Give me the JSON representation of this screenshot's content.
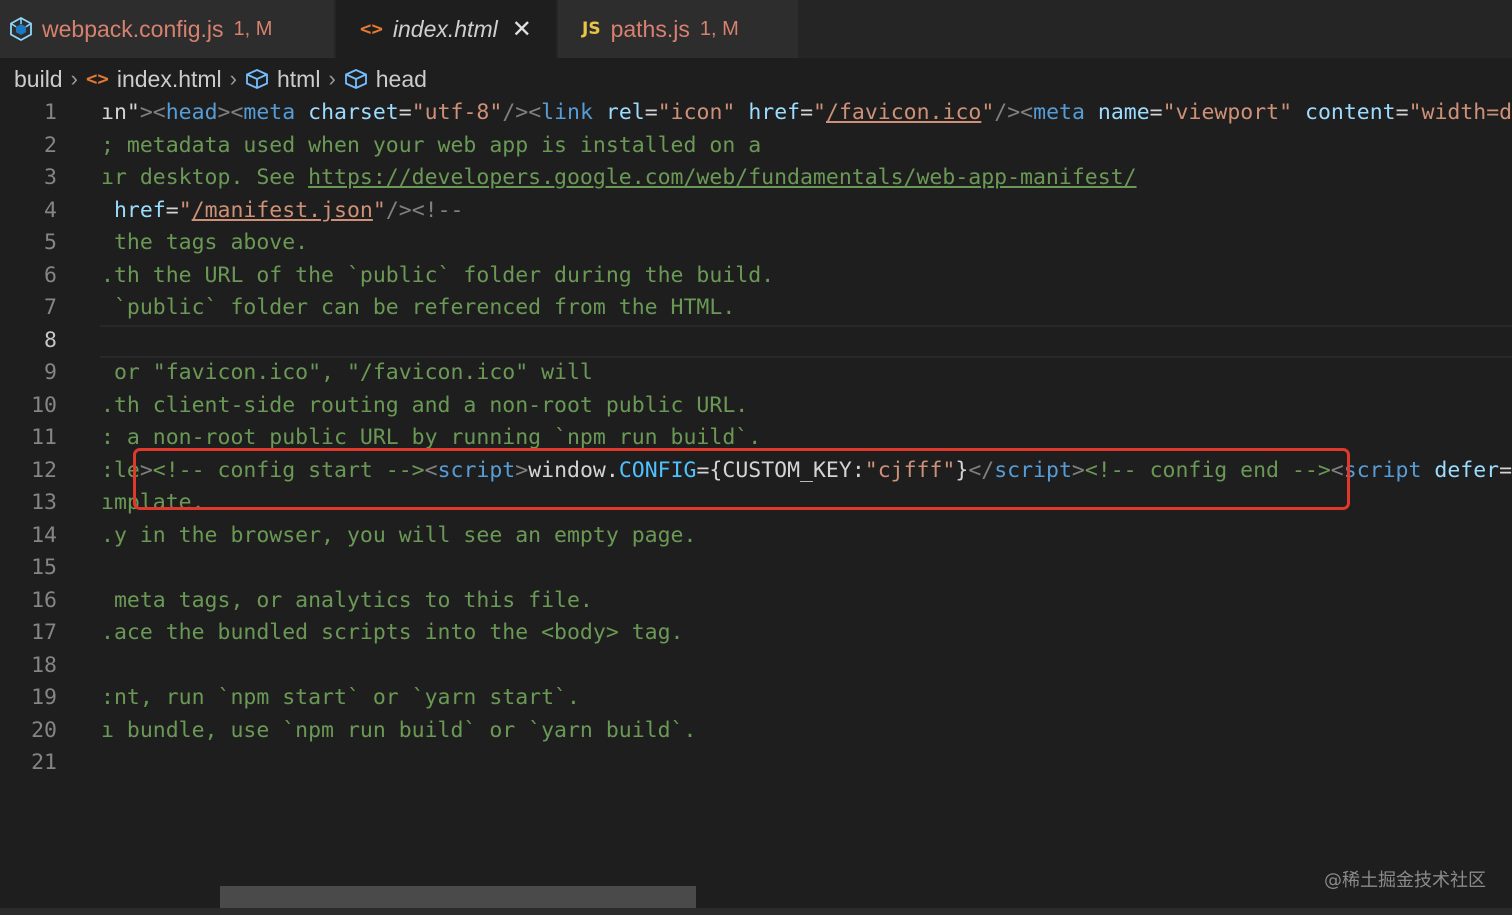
{
  "tabs": [
    {
      "name": "webpack.config.js",
      "badge": "1, M",
      "icon": "webpack-icon",
      "active": false
    },
    {
      "name": "index.html",
      "icon": "html-icon",
      "close": "✕",
      "active": true
    },
    {
      "name": "paths.js",
      "badge": "1, M",
      "icon": "js-icon",
      "icon_text": "JS",
      "active": false
    }
  ],
  "breadcrumb": [
    {
      "label": "build"
    },
    {
      "label": "index.html",
      "icon": "html-icon"
    },
    {
      "label": "html",
      "icon": "cube-icon"
    },
    {
      "label": "head",
      "icon": "cube-icon"
    }
  ],
  "editor": {
    "active_line": 8,
    "line_numbers": [
      "1",
      "2",
      "3",
      "4",
      "5",
      "6",
      "7",
      "8",
      "9",
      "10",
      "11",
      "12",
      "13",
      "14",
      "15",
      "16",
      "17",
      "18",
      "19",
      "20",
      "21"
    ],
    "lines": {
      "l1": [
        {
          "c": "txt",
          "t": "ın\""
        },
        {
          "c": "pun",
          "t": "><"
        },
        {
          "c": "tag",
          "t": "head"
        },
        {
          "c": "pun",
          "t": "><"
        },
        {
          "c": "tag",
          "t": "meta"
        },
        {
          "c": "txt",
          "t": " "
        },
        {
          "c": "attr",
          "t": "charset"
        },
        {
          "c": "txt",
          "t": "="
        },
        {
          "c": "str",
          "t": "\"utf-8\""
        },
        {
          "c": "pun",
          "t": "/><"
        },
        {
          "c": "tag",
          "t": "link"
        },
        {
          "c": "txt",
          "t": " "
        },
        {
          "c": "attr",
          "t": "rel"
        },
        {
          "c": "txt",
          "t": "="
        },
        {
          "c": "str",
          "t": "\"icon\""
        },
        {
          "c": "txt",
          "t": " "
        },
        {
          "c": "attr",
          "t": "href"
        },
        {
          "c": "txt",
          "t": "="
        },
        {
          "c": "str",
          "t": "\""
        },
        {
          "c": "lnk",
          "t": "/favicon.ico"
        },
        {
          "c": "str",
          "t": "\""
        },
        {
          "c": "pun",
          "t": "/><"
        },
        {
          "c": "tag",
          "t": "meta"
        },
        {
          "c": "txt",
          "t": " "
        },
        {
          "c": "attr",
          "t": "name"
        },
        {
          "c": "txt",
          "t": "="
        },
        {
          "c": "str",
          "t": "\"viewport\""
        },
        {
          "c": "txt",
          "t": " "
        },
        {
          "c": "attr",
          "t": "content"
        },
        {
          "c": "txt",
          "t": "="
        },
        {
          "c": "str",
          "t": "\"width=d"
        }
      ],
      "l2": [
        {
          "c": "cmt",
          "t": "; metadata used when your web app is installed on a"
        }
      ],
      "l3": [
        {
          "c": "cmt",
          "t": "ır desktop. See "
        },
        {
          "c": "cmlnk",
          "t": "https://developers.google.com/web/fundamentals/web-app-manifest/"
        }
      ],
      "l4": [
        {
          "c": "txt",
          "t": " "
        },
        {
          "c": "attr",
          "t": "href"
        },
        {
          "c": "txt",
          "t": "="
        },
        {
          "c": "str",
          "t": "\""
        },
        {
          "c": "lnk",
          "t": "/manifest.json"
        },
        {
          "c": "str",
          "t": "\""
        },
        {
          "c": "pun",
          "t": "/><!--"
        }
      ],
      "l5": [
        {
          "c": "cmt",
          "t": " the tags above."
        }
      ],
      "l6": [
        {
          "c": "cmt",
          "t": ".th the URL of the `public` folder during the build."
        }
      ],
      "l7": [
        {
          "c": "cmt",
          "t": " `public` folder can be referenced from the HTML."
        }
      ],
      "l8": [],
      "l9": [
        {
          "c": "cmt",
          "t": " or \"favicon.ico\", \"/favicon.ico\" will"
        }
      ],
      "l10": [
        {
          "c": "cmt",
          "t": ".th client-side routing and a non-root public URL."
        }
      ],
      "l11": [
        {
          "c": "cmt",
          "t": ": a non-root public URL by running `npm run build`."
        }
      ],
      "l12": [
        {
          "c": "cmt",
          "t": ":le"
        },
        {
          "c": "pun",
          "t": ">"
        },
        {
          "c": "cmt",
          "t": "<!-- config start -->"
        },
        {
          "c": "pun",
          "t": "<"
        },
        {
          "c": "tag",
          "t": "script"
        },
        {
          "c": "pun",
          "t": ">"
        },
        {
          "c": "txt",
          "t": "window."
        },
        {
          "c": "prop",
          "t": "CONFIG"
        },
        {
          "c": "txt",
          "t": "={CUSTOM_KEY:"
        },
        {
          "c": "str",
          "t": "\"cjfff\""
        },
        {
          "c": "txt",
          "t": "}"
        },
        {
          "c": "pun",
          "t": "</"
        },
        {
          "c": "tag",
          "t": "script"
        },
        {
          "c": "pun",
          "t": ">"
        },
        {
          "c": "cmt",
          "t": "<!-- config end -->"
        },
        {
          "c": "pun",
          "t": "<"
        },
        {
          "c": "tag",
          "t": "script"
        },
        {
          "c": "txt",
          "t": " "
        },
        {
          "c": "attr",
          "t": "defer"
        },
        {
          "c": "txt",
          "t": "="
        }
      ],
      "l13": [
        {
          "c": "cmt",
          "t": "ımplate."
        }
      ],
      "l14": [
        {
          "c": "cmt",
          "t": ".y in the browser, you will see an empty page."
        }
      ],
      "l15": [],
      "l16": [
        {
          "c": "cmt",
          "t": " meta tags, or analytics to this file."
        }
      ],
      "l17": [
        {
          "c": "cmt",
          "t": ".ace the bundled scripts into the <body> tag."
        }
      ],
      "l18": [],
      "l19": [
        {
          "c": "cmt",
          "t": ":nt, run `npm start` or `yarn start`."
        }
      ],
      "l20": [
        {
          "c": "cmt",
          "t": "ı bundle, use `npm run build` or `yarn build`."
        }
      ],
      "l21": []
    }
  },
  "watermark": "@稀土掘金技术社区",
  "colors": {
    "modified": "#d7816f",
    "highlight_box": "#e0382b",
    "js_icon": "#e8c547",
    "html_icon": "#e37933",
    "webpack_icon": "#8ed6fb"
  }
}
